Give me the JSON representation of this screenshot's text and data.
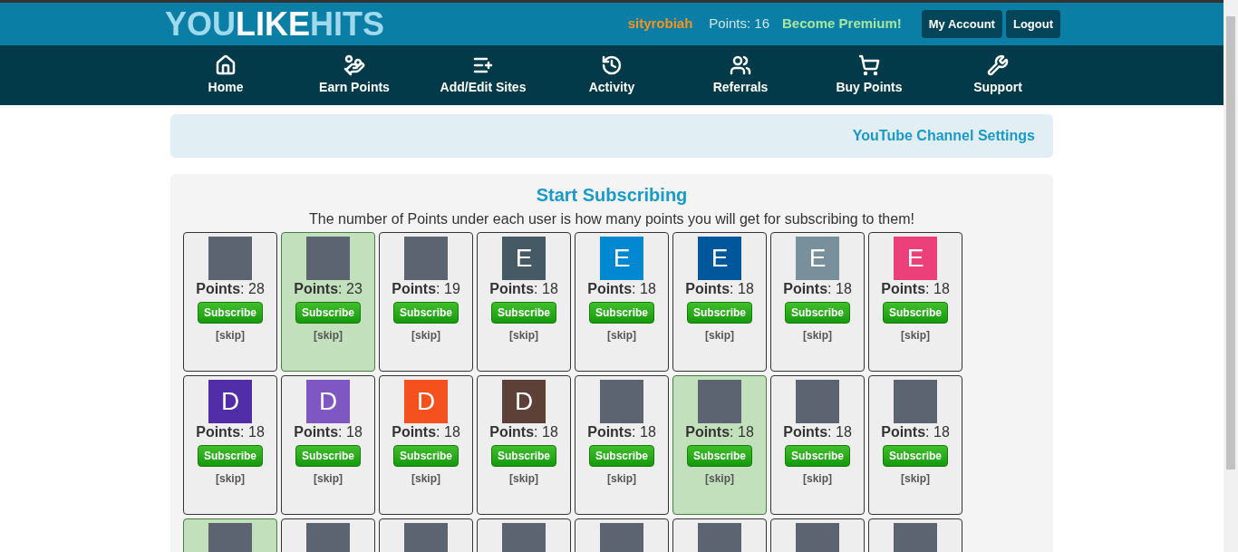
{
  "header": {
    "logo": [
      {
        "text": "YOU",
        "color": "#9fd9ee"
      },
      {
        "text": "LIKE",
        "color": "#ffffff"
      },
      {
        "text": "HITS",
        "color": "#9fd9ee"
      }
    ],
    "username": "sityrobiah",
    "points": "Points: 16",
    "premium": "Become Premium!",
    "buttons": [
      "My Account",
      "Logout"
    ]
  },
  "nav": [
    {
      "label": "Home"
    },
    {
      "label": "Earn Points"
    },
    {
      "label": "Add/Edit Sites"
    },
    {
      "label": "Activity"
    },
    {
      "label": "Referrals"
    },
    {
      "label": "Buy Points"
    },
    {
      "label": "Support"
    }
  ],
  "settings_link": "YouTube Channel Settings",
  "title": "Start Subscribing",
  "subtitle": "The number of Points under each user is how many points you will get for subscribing to them!",
  "cards": [
    {
      "avatar": {
        "kind": "photo"
      },
      "points": "**Points**: 28",
      "button": "Subscribe",
      "skip": "[skip]",
      "highlighted": false
    },
    {
      "avatar": {
        "kind": "photo"
      },
      "points": "**Points**: 23",
      "button": "Subscribe",
      "skip": "[skip]",
      "highlighted": true
    },
    {
      "avatar": {
        "kind": "photo"
      },
      "points": "**Points**: 19",
      "button": "Subscribe",
      "skip": "[skip]",
      "highlighted": false
    },
    {
      "avatar": {
        "kind": "letter",
        "letter": "E",
        "color": "#455a64"
      },
      "points": "**Points**: 18",
      "button": "Subscribe",
      "skip": "[skip]",
      "highlighted": false
    },
    {
      "avatar": {
        "kind": "letter",
        "letter": "E",
        "color": "#0288d1"
      },
      "points": "**Points**: 18",
      "button": "Subscribe",
      "skip": "[skip]",
      "highlighted": false
    },
    {
      "avatar": {
        "kind": "letter",
        "letter": "E",
        "color": "#01579b"
      },
      "points": "**Points**: 18",
      "button": "Subscribe",
      "skip": "[skip]",
      "highlighted": false
    },
    {
      "avatar": {
        "kind": "letter",
        "letter": "E",
        "color": "#78909c"
      },
      "points": "**Points**: 18",
      "button": "Subscribe",
      "skip": "[skip]",
      "highlighted": false
    },
    {
      "avatar": {
        "kind": "letter",
        "letter": "E",
        "color": "#ec407a"
      },
      "points": "**Points**: 18",
      "button": "Subscribe",
      "skip": "[skip]",
      "highlighted": false
    },
    {
      "avatar": {
        "kind": "letter",
        "letter": "D",
        "color": "#512da8"
      },
      "points": "**Points**: 18",
      "button": "Subscribe",
      "skip": "[skip]",
      "highlighted": false
    },
    {
      "avatar": {
        "kind": "letter",
        "letter": "D",
        "color": "#7e57c2"
      },
      "points": "**Points**: 18",
      "button": "Subscribe",
      "skip": "[skip]",
      "highlighted": false
    },
    {
      "avatar": {
        "kind": "letter",
        "letter": "D",
        "color": "#f4511e"
      },
      "points": "**Points**: 18",
      "button": "Subscribe",
      "skip": "[skip]",
      "highlighted": false
    },
    {
      "avatar": {
        "kind": "letter",
        "letter": "D",
        "color": "#5d4037"
      },
      "points": "**Points**: 18",
      "button": "Subscribe",
      "skip": "[skip]",
      "highlighted": false
    },
    {
      "avatar": {
        "kind": "photo"
      },
      "points": "**Points**: 18",
      "button": "Subscribe",
      "skip": "[skip]",
      "highlighted": false
    },
    {
      "avatar": {
        "kind": "photo"
      },
      "points": "**Points**: 18",
      "button": "Subscribe",
      "skip": "[skip]",
      "highlighted": true
    },
    {
      "avatar": {
        "kind": "photo"
      },
      "points": "**Points**: 18",
      "button": "Subscribe",
      "skip": "[skip]",
      "highlighted": false
    },
    {
      "avatar": {
        "kind": "photo"
      },
      "points": "**Points**: 18",
      "button": "Subscribe",
      "skip": "[skip]",
      "highlighted": false
    },
    {
      "avatar": {
        "kind": "photo"
      },
      "highlighted": true
    },
    {
      "avatar": {
        "kind": "photo"
      },
      "highlighted": false
    },
    {
      "avatar": {
        "kind": "photo"
      },
      "highlighted": false
    },
    {
      "avatar": {
        "kind": "photo"
      },
      "highlighted": false
    },
    {
      "avatar": {
        "kind": "photo"
      },
      "highlighted": false
    },
    {
      "avatar": {
        "kind": "photo"
      },
      "highlighted": false
    },
    {
      "avatar": {
        "kind": "photo"
      },
      "highlighted": false
    },
    {
      "avatar": {
        "kind": "photo"
      },
      "highlighted": false
    }
  ]
}
